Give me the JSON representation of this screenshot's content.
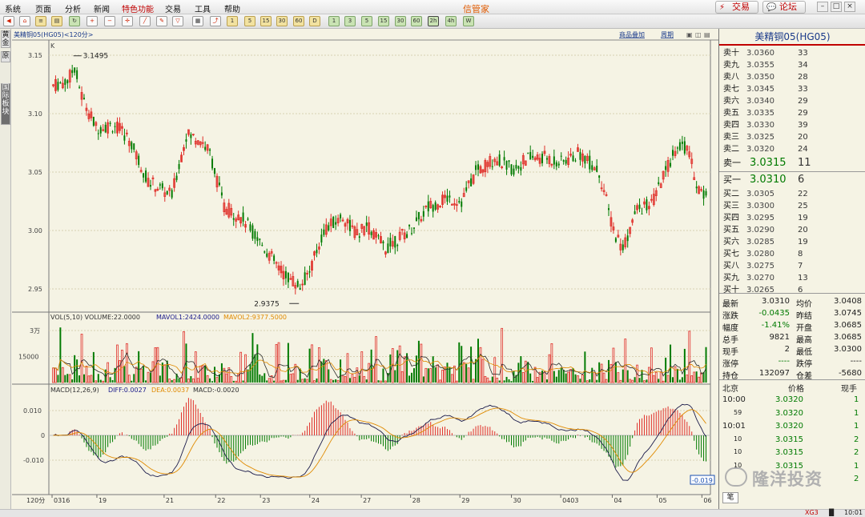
{
  "menu": [
    "系统",
    "页面",
    "分析",
    "新闻",
    "特色功能",
    "交易",
    "工具",
    "帮助"
  ],
  "app_title": "信管家",
  "top_buttons": {
    "trade": "交易",
    "forum": "论坛"
  },
  "side_tabs": [
    "黄金",
    "原",
    "国际板块"
  ],
  "chart_header": {
    "title": "美精铜05(HG05)<120分>",
    "link1": "商品叠加",
    "link2": "周期"
  },
  "kline": {
    "label": "K",
    "y_ticks": [
      "3.15",
      "3.10",
      "3.05",
      "3.00",
      "2.95"
    ],
    "high_label": "3.1495",
    "low_label": "2.9375"
  },
  "volume": {
    "title": "VOL(5,10) VOLUME:22.0000",
    "mavol1": "MAVOL1:2424.0000",
    "mavol2": "MAVOL2:9377.5000",
    "y_ticks": [
      "3万",
      "15000"
    ]
  },
  "macd": {
    "title": "MACD(12,26,9)",
    "diff": "DIFF:0.0027",
    "dea": "DEA:0.0037",
    "macd": "MACD:-0.0020",
    "y_ticks": [
      "0.010",
      "0",
      "-0.010"
    ],
    "current_label": "-0.019"
  },
  "x_axis": {
    "period": "120分",
    "dates": [
      "0316",
      "19",
      "21",
      "22",
      "23",
      "24",
      "27",
      "28",
      "29",
      "30",
      "0403",
      "04",
      "05",
      "06"
    ]
  },
  "quote": {
    "title": "美精铜05(HG05)",
    "asks": [
      {
        "label": "卖十",
        "price": "3.0360",
        "vol": "33"
      },
      {
        "label": "卖九",
        "price": "3.0355",
        "vol": "34"
      },
      {
        "label": "卖八",
        "price": "3.0350",
        "vol": "28"
      },
      {
        "label": "卖七",
        "price": "3.0345",
        "vol": "33"
      },
      {
        "label": "卖六",
        "price": "3.0340",
        "vol": "29"
      },
      {
        "label": "卖五",
        "price": "3.0335",
        "vol": "29"
      },
      {
        "label": "卖四",
        "price": "3.0330",
        "vol": "39"
      },
      {
        "label": "卖三",
        "price": "3.0325",
        "vol": "20"
      },
      {
        "label": "卖二",
        "price": "3.0320",
        "vol": "24"
      },
      {
        "label": "卖一",
        "price": "3.0315",
        "vol": "11"
      }
    ],
    "bids": [
      {
        "label": "买一",
        "price": "3.0310",
        "vol": "6"
      },
      {
        "label": "买二",
        "price": "3.0305",
        "vol": "22"
      },
      {
        "label": "买三",
        "price": "3.0300",
        "vol": "25"
      },
      {
        "label": "买四",
        "price": "3.0295",
        "vol": "19"
      },
      {
        "label": "买五",
        "price": "3.0290",
        "vol": "20"
      },
      {
        "label": "买六",
        "price": "3.0285",
        "vol": "19"
      },
      {
        "label": "买七",
        "price": "3.0280",
        "vol": "8"
      },
      {
        "label": "买八",
        "price": "3.0275",
        "vol": "7"
      },
      {
        "label": "买九",
        "price": "3.0270",
        "vol": "13"
      },
      {
        "label": "买十",
        "price": "3.0265",
        "vol": "6"
      }
    ],
    "stats": [
      {
        "l1": "最新",
        "v1": "3.0310",
        "l2": "均价",
        "v2": "3.0408"
      },
      {
        "l1": "涨跌",
        "v1": "-0.0435",
        "l2": "昨结",
        "v2": "3.0745"
      },
      {
        "l1": "幅度",
        "v1": "-1.41%",
        "l2": "开盘",
        "v2": "3.0685"
      },
      {
        "l1": "总手",
        "v1": "9821",
        "l2": "最高",
        "v2": "3.0685"
      },
      {
        "l1": "现手",
        "v1": "2",
        "l2": "最低",
        "v2": "3.0300"
      },
      {
        "l1": "涨停",
        "v1": "----",
        "l2": "跌停",
        "v2": "----"
      },
      {
        "l1": "持仓",
        "v1": "132097",
        "l2": "仓差",
        "v2": "-5680"
      }
    ],
    "ticks_header": {
      "c1": "北京",
      "c2": "价格",
      "c3": "现手"
    },
    "ticks": [
      {
        "t": "10:00",
        "p": "3.0320",
        "v": "1"
      },
      {
        "t": "59",
        "p": "3.0320",
        "v": "1"
      },
      {
        "t": "10:01",
        "p": "3.0320",
        "v": "1"
      },
      {
        "t": "10",
        "p": "3.0315",
        "v": "2"
      },
      {
        "t": "10",
        "p": "3.0315",
        "v": "2"
      },
      {
        "t": "10",
        "p": "3.0315",
        "v": "1"
      },
      {
        "t": "",
        "p": "",
        "v": "2"
      }
    ],
    "bottom_tab": "笔"
  },
  "watermark": "隆洋投资",
  "status": {
    "signal": "XG3",
    "time": "10:01"
  },
  "colors": {
    "up": "#e0302a",
    "down": "#007a00",
    "ma1": "#2c2c2c",
    "ma2": "#e08a00",
    "bg": "#f5f3e4"
  }
}
